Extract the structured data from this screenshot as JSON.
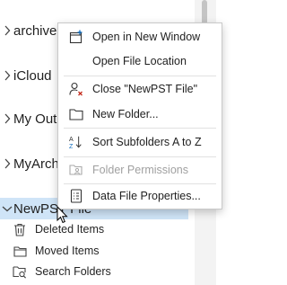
{
  "folders": {
    "archive": "archive",
    "icloud": "iCloud",
    "myout": "My Out",
    "myarch": "MyArch",
    "newpst": "NewPST File"
  },
  "subfolders": [
    {
      "label": "Deleted Items",
      "icon": "trash-icon"
    },
    {
      "label": "Moved Items",
      "icon": "folder-icon"
    },
    {
      "label": "Search Folders",
      "icon": "search-folder-icon"
    }
  ],
  "context_menu": {
    "open_new_window": "Open in New Window",
    "open_file_location": "Open File Location",
    "close_pst": "Close \"NewPST File\"",
    "new_folder": "New Folder...",
    "sort_subfolders": "Sort Subfolders A to Z",
    "folder_permissions": "Folder Permissions",
    "data_file_properties": "Data File Properties..."
  },
  "colors": {
    "selection": "#cfe4f7",
    "menu_border": "#c9c9c9",
    "icon_blue": "#0f6cbd",
    "disabled": "#a0a0a0"
  }
}
